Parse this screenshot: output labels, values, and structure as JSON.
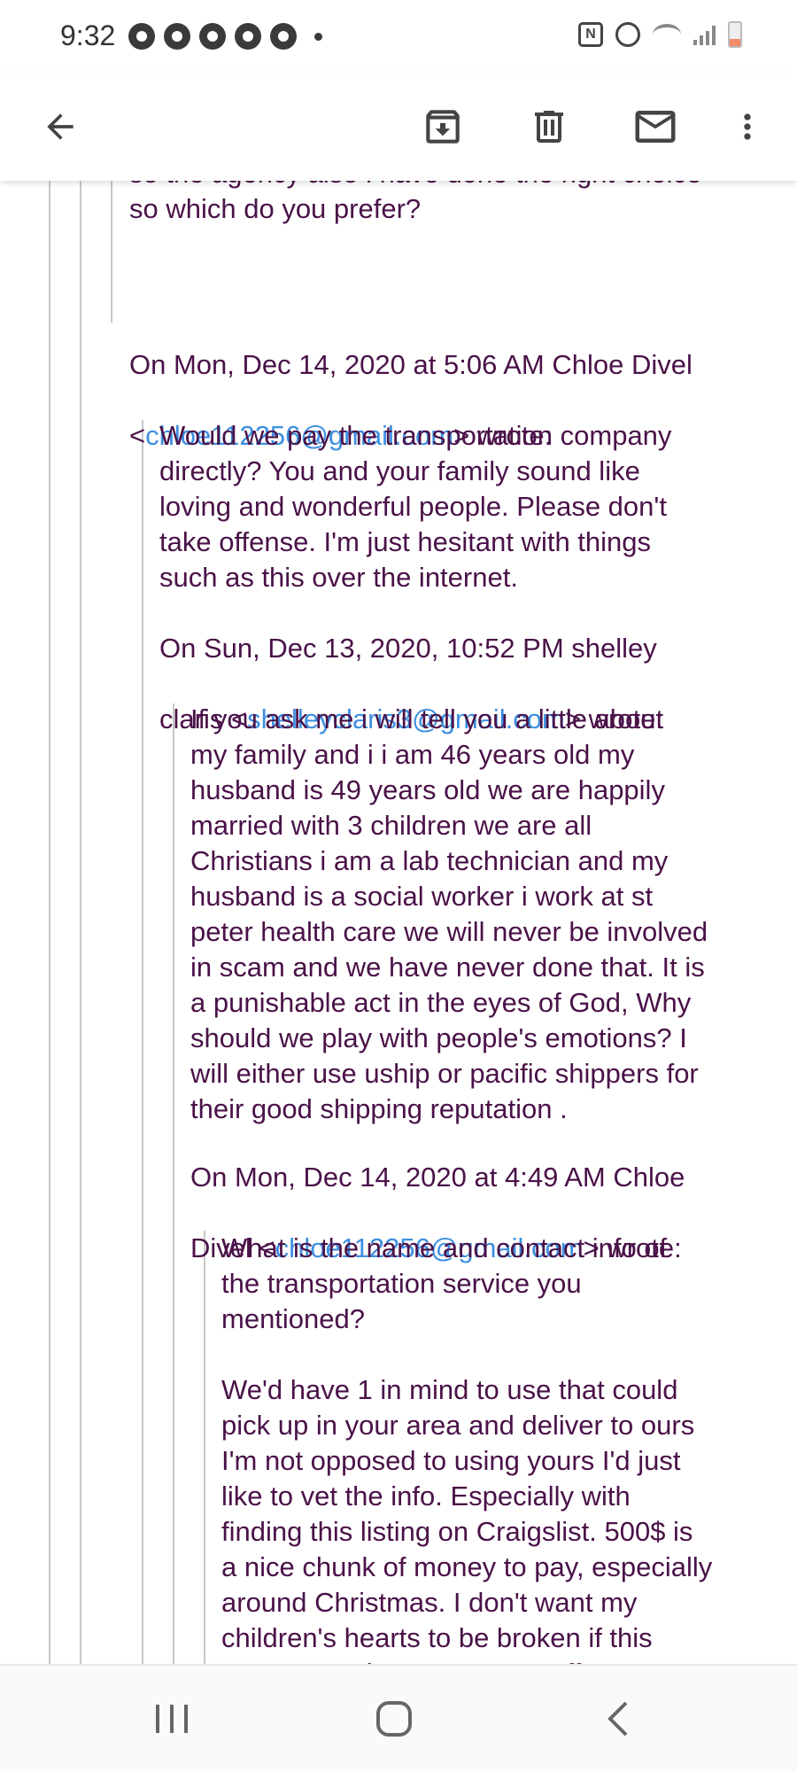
{
  "status_bar": {
    "time": "9:32",
    "left_icons": [
      "messenger-icon",
      "threads-icon",
      "facebook-icon",
      "app-icon",
      "app-icon",
      "more-notifications-dot-icon"
    ],
    "right_icons": [
      "nfc-icon",
      "alarm-icon",
      "wifi-icon",
      "signal-icon",
      "battery-icon"
    ],
    "nfc_label": "N",
    "battery_color": "#f28b6a"
  },
  "toolbar": {
    "back_icon": "arrow-back-icon",
    "archive_icon": "archive-icon",
    "delete_icon": "trash-icon",
    "unread_icon": "mail-icon",
    "more_icon": "more-vert-icon"
  },
  "thread": {
    "partial_line_top": "so the agency also i have done the right choice",
    "partial_line": "so which do you prefer?",
    "quote1": {
      "header_line1": "On Mon, Dec 14, 2020 at 5:06 AM Chloe Divel",
      "header_lt": "<",
      "email": "chloe112256@gmail.com",
      "header_gt": "> wrote:",
      "body": " Would we pay the transportation company\ndirectly? You and your family sound like\nloving and wonderful people. Please don't\ntake offense. I'm just hesitant with things\nsuch as this over the internet."
    },
    "quote2": {
      "header_line1": "On Sun, Dec 13, 2020, 10:52 PM shelley",
      "header_prefix": "claris <",
      "email": "shelleyclaris3@gmail.com",
      "header_gt": "> wrote:",
      "body": "  If you ask me i will tell you a little about\nmy family and i i am 46 years old my\nhusband is 49 years old we are happily\nmarried with 3 children we are all\nChristians i am a lab technician and my\nhusband is a social worker i work at st\npeter health care we will never be involved\nin scam and we have never done that. It is\na punishable act in the eyes of God, Why\nshould we play with people's emotions?  I\nwill either use uship or pacific shippers for\ntheir good shipping reputation ."
    },
    "quote3": {
      "header_line1": "On Mon, Dec 14, 2020 at 4:49 AM Chloe",
      "header_prefix": "Divel <",
      "email": "chloe112256@gmail.com",
      "header_gt": "> wrote:",
      "body_p1": "What is the name and contact info of\nthe transportation service you\nmentioned?",
      "body_p2": "We'd have 1 in mind to use that could\npick up in your area and deliver to ours\nI'm not opposed to using yours I'd just\nlike to vet the info. Especially with\nfinding this listing on Craigslist. 500$ is\na nice chunk of money to pay, especially\naround Christmas. I don't want my\nchildren's hearts to be broken if this\nturns out to be a scam. No offense"
    }
  },
  "nav_bar": {
    "recents_icon": "recent-apps-icon",
    "home_icon": "home-icon",
    "back_icon": "back-chevron-icon"
  },
  "colors": {
    "text": "#4a1248",
    "link": "#3d8fe0",
    "quote_line": "#c8c8c8"
  }
}
